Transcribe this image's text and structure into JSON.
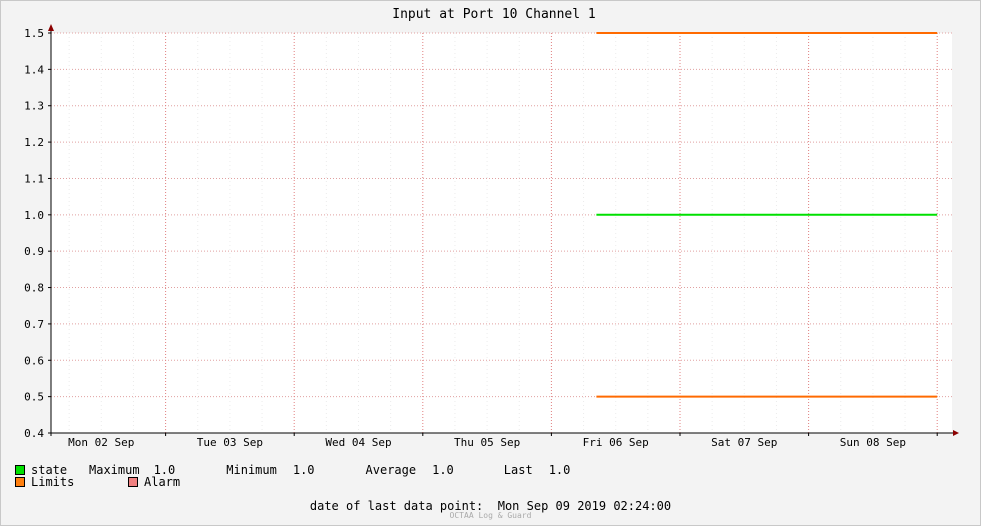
{
  "chart_data": {
    "type": "line",
    "title": "Input at Port 10 Channel 1",
    "x_tick_labels": [
      "Mon 02 Sep",
      "Tue 03 Sep",
      "Wed 04 Sep",
      "Thu 05 Sep",
      "Fri 06 Sep",
      "Sat 07 Sep",
      "Sun 08 Sep"
    ],
    "x_range_days": [
      0,
      7
    ],
    "ylim": [
      0.4,
      1.5
    ],
    "y_ticks": [
      0.4,
      0.5,
      0.6,
      0.7,
      0.8,
      0.9,
      1.0,
      1.1,
      1.2,
      1.3,
      1.4,
      1.5
    ],
    "grid": true,
    "series": [
      {
        "name": "state",
        "color": "#00e000",
        "x": [
          4.35,
          7.0
        ],
        "y": [
          1.0,
          1.0
        ]
      },
      {
        "name": "Limits",
        "color": "#ff6a00",
        "x": [
          4.35,
          7.0
        ],
        "y": [
          1.5,
          1.5
        ]
      },
      {
        "name": "Limits",
        "color": "#ff6a00",
        "x": [
          4.35,
          7.0
        ],
        "y": [
          0.5,
          0.5
        ]
      }
    ]
  },
  "legend": {
    "state": {
      "label": "state",
      "color": "#00e000"
    },
    "limits": {
      "label": "Limits",
      "color": "#ff7f0e"
    },
    "alarm": {
      "label": "Alarm",
      "color": "#f08080"
    },
    "stats": {
      "max_label": "Maximum",
      "max_value": "1.0",
      "min_label": "Minimum",
      "min_value": "1.0",
      "avg_label": "Average",
      "avg_value": "1.0",
      "last_label": "Last",
      "last_value": "1.0"
    }
  },
  "footer": {
    "last_point_label": "date of last data point:",
    "last_point_value": "Mon Sep 09 2019 02:24:00",
    "credit": "OCTAA Log & Guard"
  }
}
